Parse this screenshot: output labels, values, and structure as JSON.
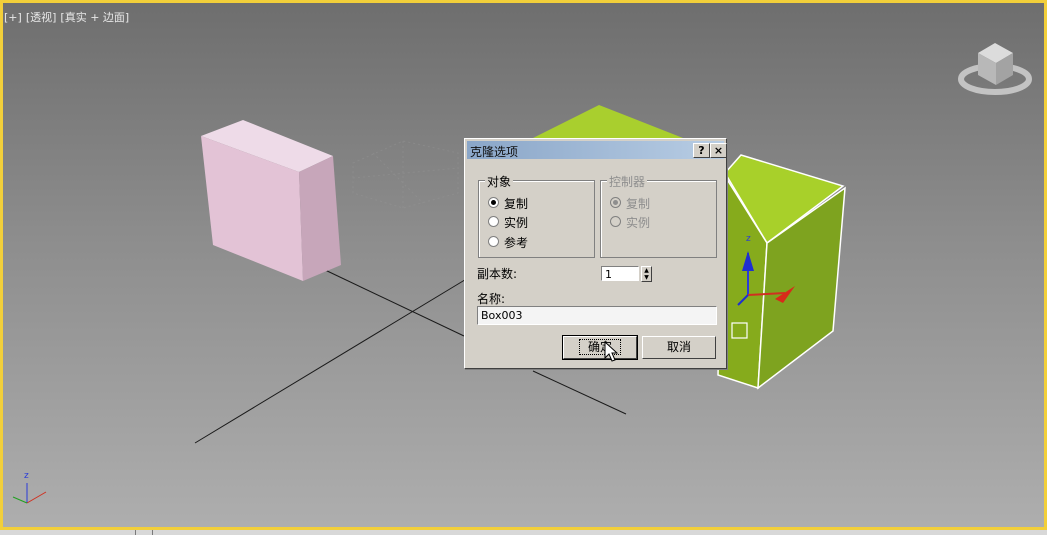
{
  "viewport": {
    "label_parts": [
      "[+]",
      "[透视]",
      "[真实 + 边面]"
    ],
    "axis_label": "z",
    "colors": {
      "border": "#f2cf3a",
      "box_pink": "#e5c5d9",
      "box_green": "#7ea31f"
    }
  },
  "dialog": {
    "title": "克隆选项",
    "help_label": "?",
    "close_label": "×",
    "object_group": {
      "legend": "对象",
      "options": [
        "复制",
        "实例",
        "参考"
      ],
      "selected": "复制"
    },
    "controller_group": {
      "legend": "控制器",
      "options": [
        "复制",
        "实例"
      ],
      "selected": "复制",
      "disabled": true
    },
    "copies_label": "副本数:",
    "copies_value": "1",
    "name_label": "名称:",
    "name_value": "Box003",
    "ok_label": "确定",
    "cancel_label": "取消"
  }
}
